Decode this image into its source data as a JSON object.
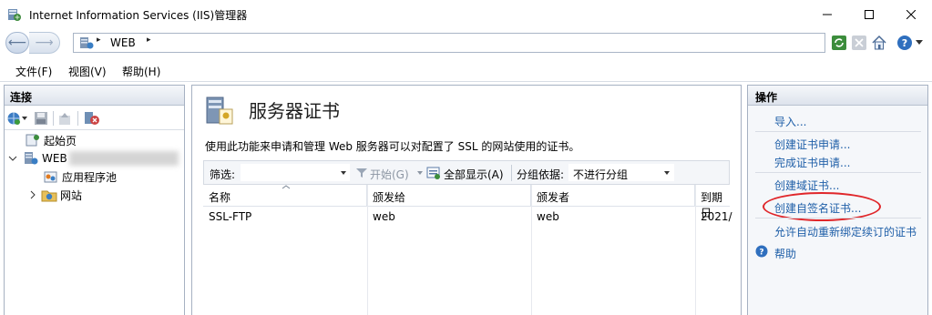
{
  "window": {
    "title": "Internet Information Services (IIS)管理器"
  },
  "address": {
    "segments": [
      "WEB"
    ],
    "separator": "▸"
  },
  "menu": [
    "文件(F)",
    "视图(V)",
    "帮助(H)"
  ],
  "left_panel": {
    "title": "连接",
    "tree": [
      {
        "label": "起始页"
      },
      {
        "label": "WEB",
        "note": ""
      },
      {
        "label": "应用程序池"
      },
      {
        "label": "网站"
      }
    ]
  },
  "center": {
    "title": "服务器证书",
    "description": "使用此功能来申请和管理 Web 服务器可以对配置了 SSL 的网站使用的证书。",
    "filter": {
      "label": "筛选:",
      "start": "开始(G)",
      "show_all": "全部显示(A)",
      "group_by": "分组依据:",
      "group_value": "不进行分组"
    },
    "columns": [
      "名称",
      "颁发给",
      "颁发者",
      "到期日"
    ],
    "rows": [
      {
        "name": "SSL-FTP",
        "issued_to": "web",
        "issuer": "web",
        "expiry": "2021/"
      }
    ]
  },
  "right_panel": {
    "title": "操作",
    "actions": [
      "导入...",
      "创建证书申请...",
      "完成证书申请...",
      "创建域证书...",
      "创建自签名证书...",
      "允许自动重新绑定续订的证书"
    ],
    "help": "帮助"
  },
  "colors": {
    "link": "#1f5fa8",
    "highlight": "#e0262a",
    "panel_border": "#a6b1c2"
  }
}
